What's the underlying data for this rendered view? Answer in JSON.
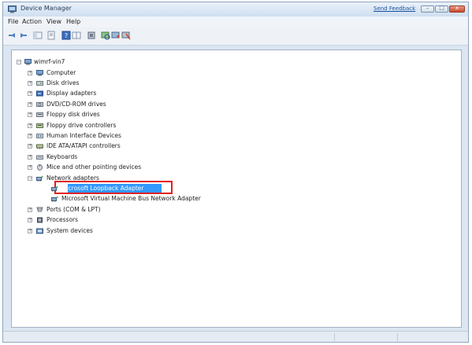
{
  "window": {
    "title": "Device Manager",
    "send_feedback": "Send Feedback",
    "min_glyph": "–",
    "max_glyph": "□",
    "close_glyph": "x"
  },
  "menu": [
    "File",
    "Action",
    "View",
    "Help"
  ],
  "toolbar_icons": [
    "back-arrow-icon",
    "forward-arrow-icon",
    "show-hide-console-tree-icon",
    "properties-icon",
    "help-icon",
    "details-pane-icon",
    "show-hidden-devices-icon",
    "scan-for-hardware-changes-icon",
    "update-driver-icon",
    "disable-device-icon"
  ],
  "tree": {
    "root": "wimrf-vin7",
    "items": [
      {
        "label": "Computer",
        "icon": "computer-icon"
      },
      {
        "label": "Disk drives",
        "icon": "disk-drive-icon"
      },
      {
        "label": "Display adapters",
        "icon": "display-adapter-icon"
      },
      {
        "label": "DVD/CD-ROM drives",
        "icon": "dvd-drive-icon"
      },
      {
        "label": "Floppy disk drives",
        "icon": "floppy-disk-icon"
      },
      {
        "label": "Floppy drive controllers",
        "icon": "floppy-controller-icon"
      },
      {
        "label": "Human Interface Devices",
        "icon": "hid-icon"
      },
      {
        "label": "IDE ATA/ATAPI controllers",
        "icon": "ide-controller-icon"
      },
      {
        "label": "Keyboards",
        "icon": "keyboard-icon"
      },
      {
        "label": "Mice and other pointing devices",
        "icon": "mouse-icon"
      },
      {
        "label": "Network adapters",
        "icon": "network-adapter-icon"
      },
      {
        "label": "Ports (COM & LPT)",
        "icon": "port-icon"
      },
      {
        "label": "Processors",
        "icon": "processor-icon"
      },
      {
        "label": "System devices",
        "icon": "system-device-icon"
      }
    ],
    "network_children": [
      {
        "label": "Microsoft Loopback Adapter",
        "icon": "network-adapter-icon",
        "selected": true
      },
      {
        "label": "Microsoft Virtual Machine Bus Network Adapter",
        "icon": "network-adapter-icon",
        "selected": false
      }
    ],
    "expand_glyph": "+",
    "collapse_glyph": "−"
  },
  "colors": {
    "selection": "#3399ff",
    "highlight_box": "#e02020",
    "titlebar": "#dbe6f2"
  }
}
